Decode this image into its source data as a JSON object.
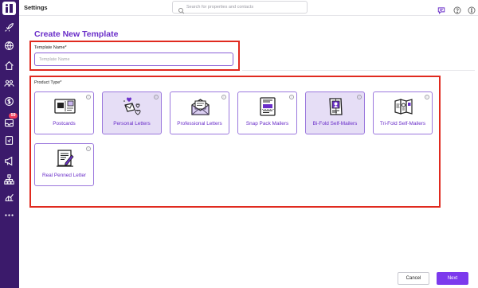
{
  "app": {
    "title": "Settings"
  },
  "search": {
    "placeholder": "Search for properties and contacts"
  },
  "sidebar": {
    "badge_count": "59",
    "icons": [
      "rocket-icon",
      "globe-icon",
      "home-icon",
      "contacts-icon",
      "dollar-icon",
      "inbox-icon",
      "document-icon",
      "megaphone-icon",
      "hierarchy-icon",
      "analytics-icon",
      "more-icon"
    ]
  },
  "header_icons": [
    "chat-icon",
    "help-icon",
    "more-vertical-icon"
  ],
  "page": {
    "title": "Create New Template",
    "template_name_label": "Template Name*",
    "template_name_placeholder": "Template Name",
    "template_name_value": "",
    "product_type_label": "Product Type*"
  },
  "product_types": [
    {
      "label": "Postcards",
      "icon": "postcard-icon",
      "selected": false
    },
    {
      "label": "Personal Letters",
      "icon": "personal-letter-icon",
      "selected": true
    },
    {
      "label": "Professional Letters",
      "icon": "professional-letter-icon",
      "selected": false
    },
    {
      "label": "Snap Pack Mailers",
      "icon": "snap-pack-icon",
      "selected": false
    },
    {
      "label": "Bi-Fold Self-Mailers",
      "icon": "bi-fold-icon",
      "selected": true
    },
    {
      "label": "Tri-Fold Self-Mailers",
      "icon": "tri-fold-icon",
      "selected": false
    },
    {
      "label": "Real Penned Letter",
      "icon": "penned-letter-icon",
      "selected": false
    }
  ],
  "info_glyph": "i",
  "footer": {
    "cancel_label": "Cancel",
    "next_label": "Next"
  },
  "colors": {
    "accent": "#6a2ec9",
    "sidebar": "#3b1a6b",
    "highlight": "#e02a1f",
    "button": "#7c3aed",
    "selected_card": "#e6def6"
  }
}
